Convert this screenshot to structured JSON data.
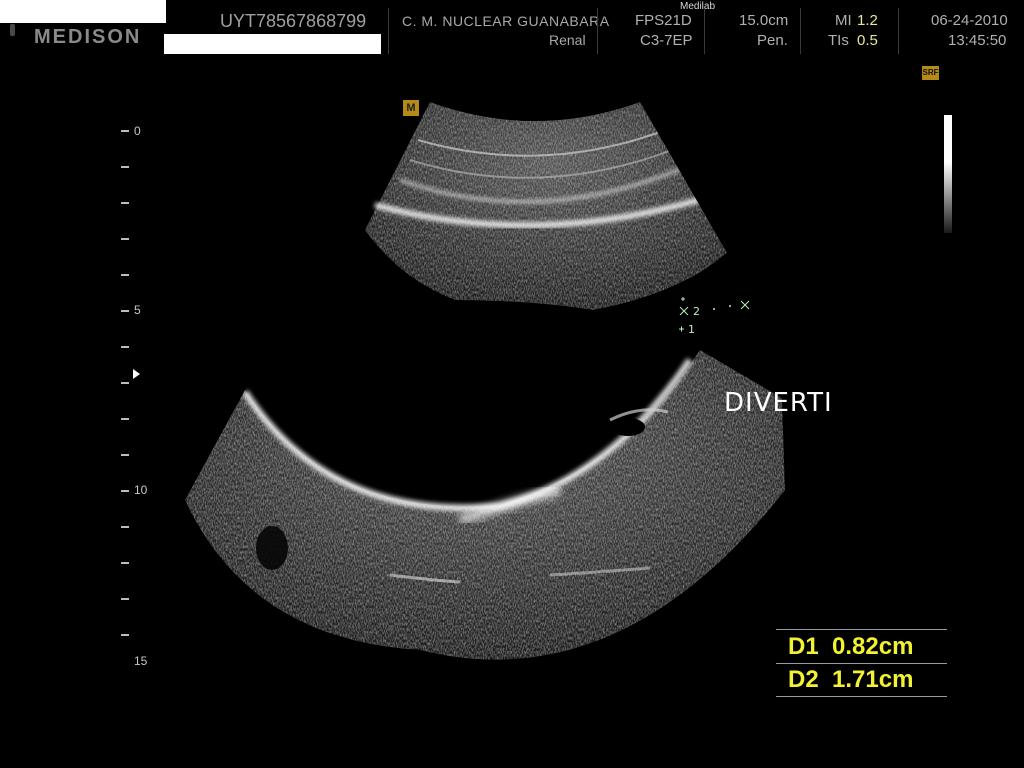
{
  "header": {
    "brand": "MEDISON",
    "patient_id": "UYT78567868799",
    "institution": "C. M. NUCLEAR  GUANABARA",
    "preset": "Renal",
    "watermark": "Medilab",
    "frequency": "FPS21D",
    "probe": "C3-7EP",
    "depth": "15.0cm",
    "harmonic_mode": "Pen.",
    "mi_label": "MI",
    "mi_value": "1.2",
    "tis_label": "TIs",
    "tis_value": "0.5",
    "date": "06-24-2010",
    "time": "13:45:50"
  },
  "image": {
    "sri_badge": "SRF",
    "m_badge": "M",
    "depth_labels": [
      "0",
      "5",
      "10",
      "15"
    ],
    "annotation": "DIVERTI",
    "calipers": [
      "2",
      "1"
    ]
  },
  "measurements": [
    {
      "label": "D1",
      "value": "0.82cm"
    },
    {
      "label": "D2",
      "value": "1.71cm"
    }
  ],
  "colors": {
    "background": "#000000",
    "measurement_text": "#f2f230",
    "badge": "#b58a16",
    "caliper": "#b8f0b8"
  }
}
